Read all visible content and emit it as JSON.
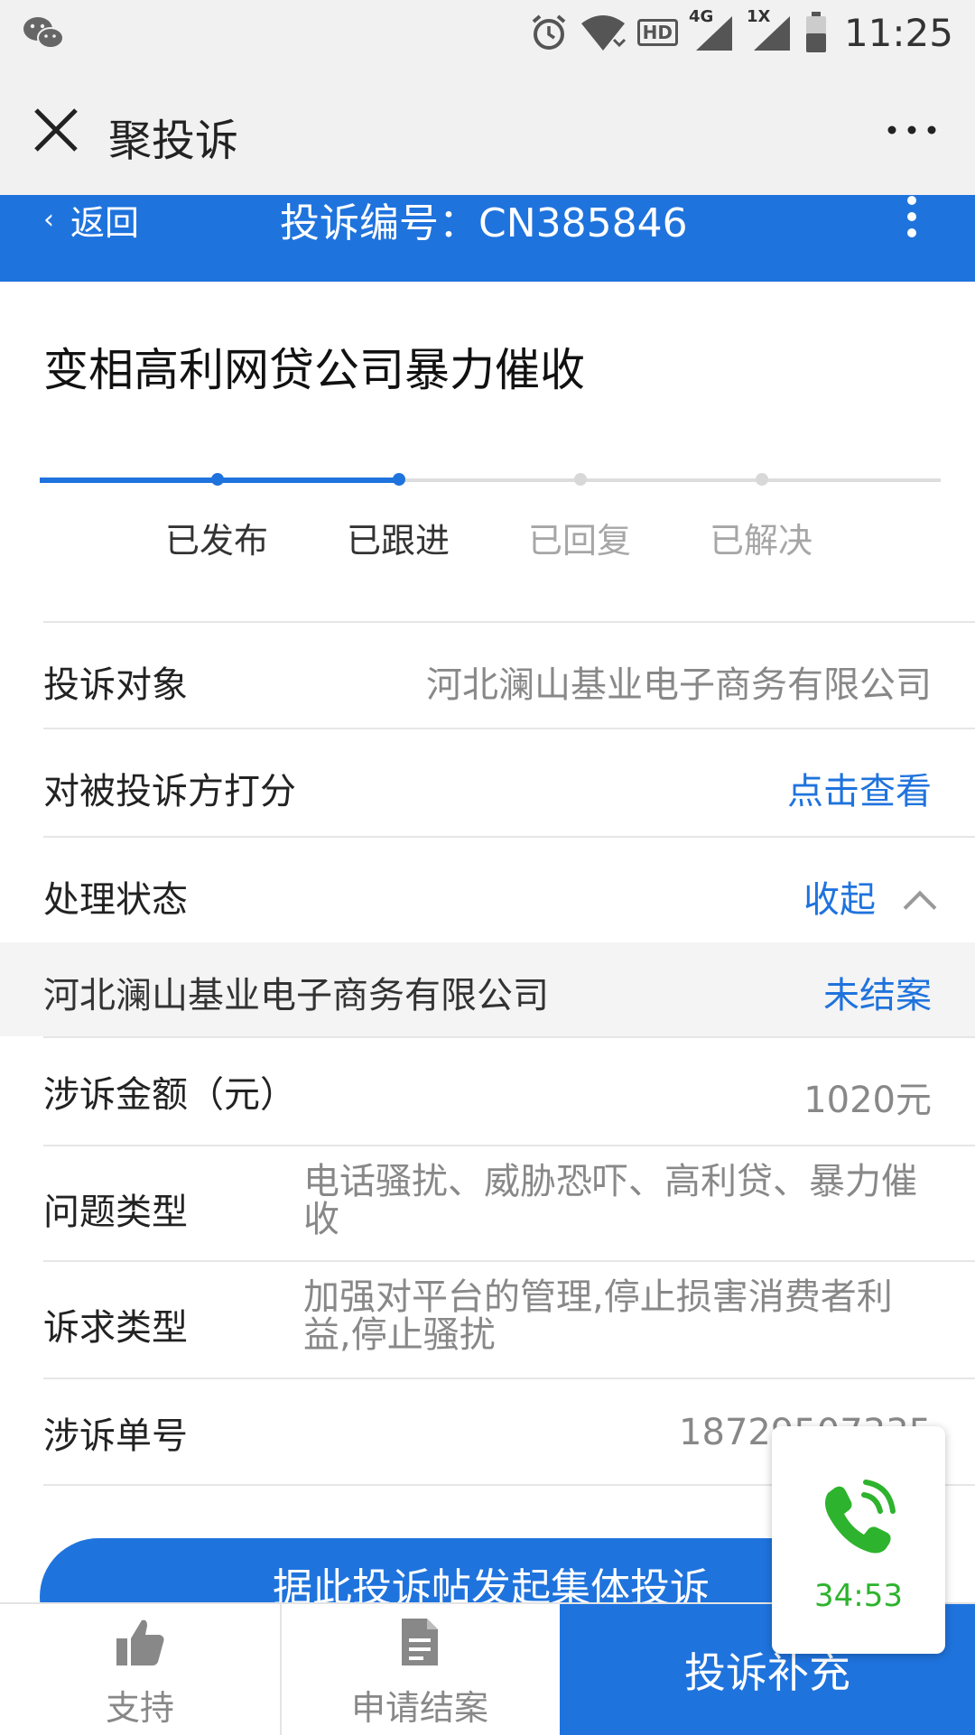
{
  "status_bar": {
    "time": "11:25",
    "hd": "HD",
    "net1": "4G",
    "net2": "1X",
    "icons": [
      "wechat-icon",
      "alarm-icon",
      "wifi-icon",
      "signal-icon",
      "battery-icon"
    ]
  },
  "wechat_header": {
    "title": "聚投诉",
    "icons": [
      "close-icon",
      "more-icon"
    ]
  },
  "nav": {
    "back_label": "返回",
    "complaint_number": "投诉编号：CN385846"
  },
  "complaint": {
    "title": "变相高利网贷公司暴力催收"
  },
  "progress": {
    "steps": [
      {
        "label": "已发布",
        "done": true
      },
      {
        "label": "已跟进",
        "done": true
      },
      {
        "label": "已回复",
        "done": false
      },
      {
        "label": "已解决",
        "done": false
      }
    ]
  },
  "details": {
    "target_label": "投诉对象",
    "target_value": "河北澜山基业电子商务有限公司",
    "rating_label": "对被投诉方打分",
    "rating_link": "点击查看",
    "status_label": "处理状态",
    "status_toggle": "收起",
    "company_name": "河北澜山基业电子商务有限公司",
    "company_status": "未结案",
    "amount_label": "涉诉金额（元）",
    "amount_value": "1020元",
    "issue_label": "问题类型",
    "issue_value": "电话骚扰、威胁恐吓、高利贷、暴力催收",
    "demand_label": "诉求类型",
    "demand_value": "加强对平台的管理,停止损害消费者利益,停止骚扰",
    "case_label": "涉诉单号",
    "case_value": "18729507335"
  },
  "collective_button": "据此投诉帖发起集体投诉",
  "bottom_bar": {
    "support": "支持",
    "apply_close": "申请结案",
    "supplement": "投诉补充"
  },
  "call_widget": {
    "timer": "34:53",
    "accent": "#2db32d"
  },
  "colors": {
    "brand_blue": "#1f73dd",
    "muted_text": "#888888"
  }
}
